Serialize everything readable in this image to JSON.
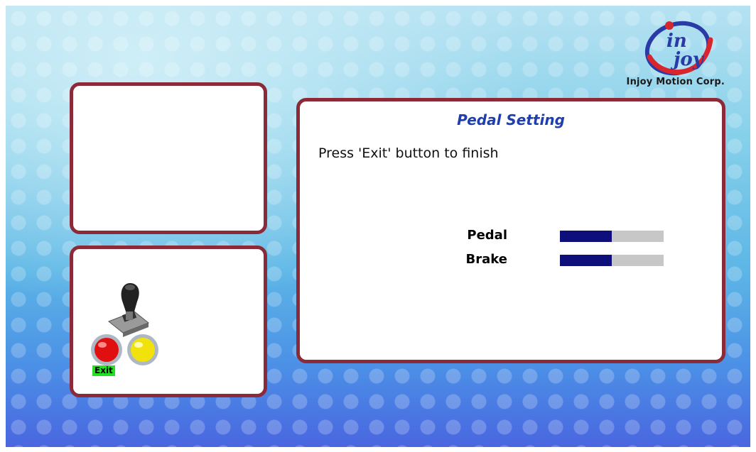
{
  "brand": {
    "name": "Injoy Motion Corp.",
    "logo_text_top": "in",
    "logo_text_bottom": "joy"
  },
  "main_panel": {
    "title": "Pedal Setting",
    "instruction": "Press 'Exit' button to finish",
    "meters": [
      {
        "label": "Pedal",
        "value_fraction": 0.5
      },
      {
        "label": "Brake",
        "value_fraction": 0.5
      }
    ]
  },
  "controls_panel": {
    "exit_label": "Exit"
  },
  "colors": {
    "panel_border": "#8b2b39",
    "title": "#1f3fae",
    "bar_fill": "#0f0f7c",
    "bar_track": "#c7c7c7",
    "exit_badge": "#22e022",
    "red_button": "#e01010",
    "yellow_button": "#f2e20c"
  }
}
